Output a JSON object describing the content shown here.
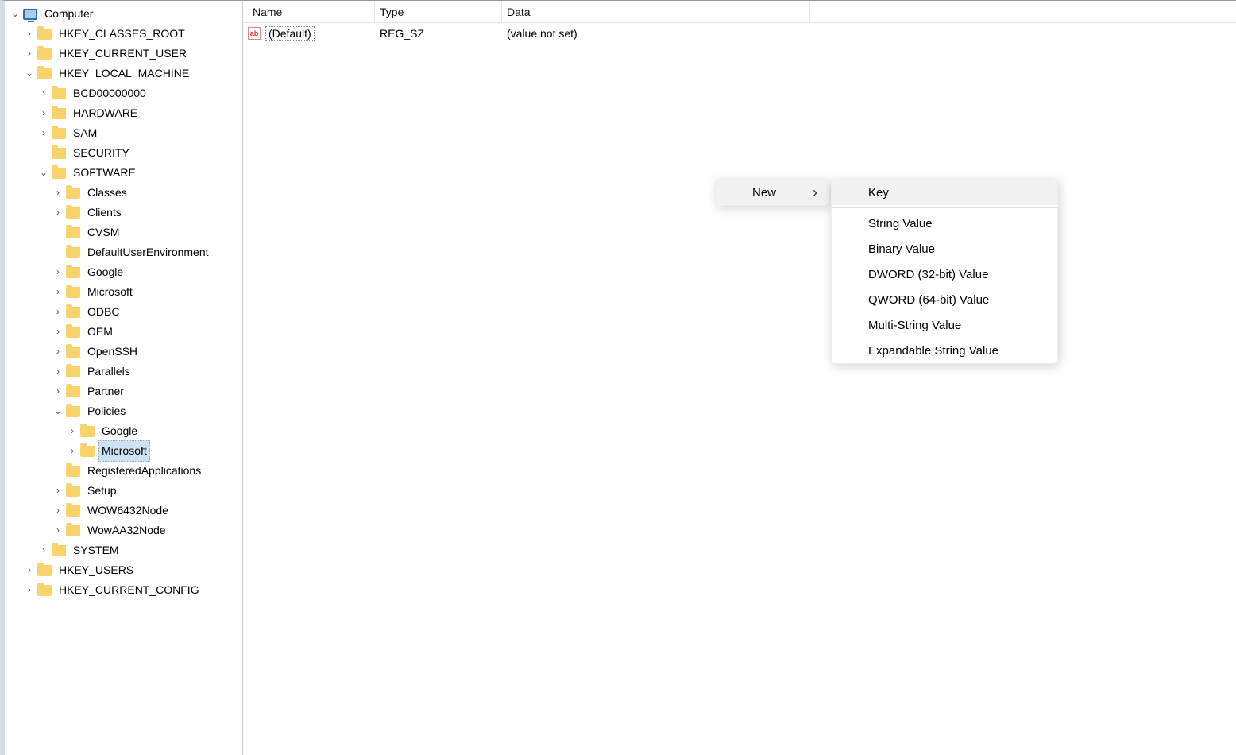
{
  "tree": {
    "root": "Computer",
    "n0": "HKEY_CLASSES_ROOT",
    "n1": "HKEY_CURRENT_USER",
    "n2": "HKEY_LOCAL_MACHINE",
    "n2_0": "BCD00000000",
    "n2_1": "HARDWARE",
    "n2_2": "SAM",
    "n2_3": "SECURITY",
    "n2_4": "SOFTWARE",
    "n2_4_0": "Classes",
    "n2_4_1": "Clients",
    "n2_4_2": "CVSM",
    "n2_4_3": "DefaultUserEnvironment",
    "n2_4_4": "Google",
    "n2_4_5": "Microsoft",
    "n2_4_6": "ODBC",
    "n2_4_7": "OEM",
    "n2_4_8": "OpenSSH",
    "n2_4_9": "Parallels",
    "n2_4_10": "Partner",
    "n2_4_11": "Policies",
    "n2_4_11_0": "Google",
    "n2_4_11_1": "Microsoft",
    "n2_4_12": "RegisteredApplications",
    "n2_4_13": "Setup",
    "n2_4_14": "WOW6432Node",
    "n2_4_15": "WowAA32Node",
    "n2_5": "SYSTEM",
    "n3": "HKEY_USERS",
    "n4": "HKEY_CURRENT_CONFIG"
  },
  "columns": {
    "name": "Name",
    "type": "Type",
    "data": "Data"
  },
  "value": {
    "icon_text": "ab",
    "name": "(Default)",
    "type": "REG_SZ",
    "data": "(value not set)"
  },
  "menu1": {
    "new": "New"
  },
  "menu2": {
    "key": "Key",
    "string": "String Value",
    "binary": "Binary Value",
    "dword": "DWORD (32-bit) Value",
    "qword": "QWORD (64-bit) Value",
    "multi": "Multi-String Value",
    "expand": "Expandable String Value"
  }
}
